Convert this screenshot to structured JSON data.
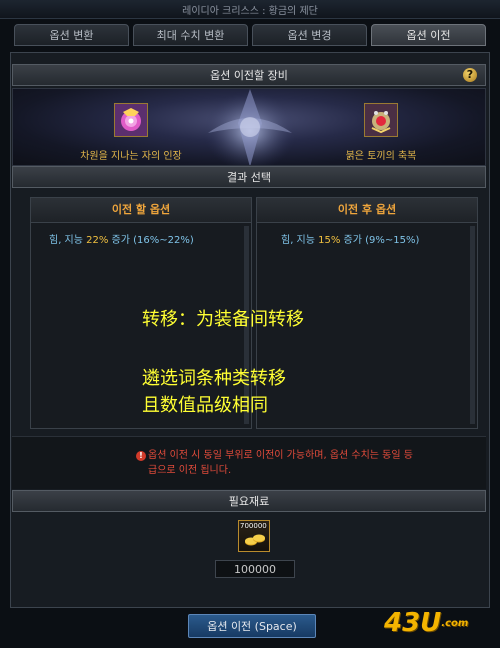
{
  "window": {
    "title": "레이디아 크리스스 : 황금의 제단"
  },
  "tabs": [
    {
      "label": "옵션 변환",
      "active": false
    },
    {
      "label": "최대 수치 변환",
      "active": false
    },
    {
      "label": "옵션 변경",
      "active": false
    },
    {
      "label": "옵션 이전",
      "active": true
    }
  ],
  "transfer_equipment": {
    "header": "옵션 이전할 장비",
    "help_icon": "?",
    "left_item": {
      "name": "차원을 지나는 자의 인장",
      "icon": "seal-icon"
    },
    "right_item": {
      "name": "붉은 토끼의 축복",
      "icon": "rabbit-blessing-icon"
    }
  },
  "result": {
    "header": "결과 선택",
    "before": {
      "title": "이전 할 옵션",
      "option_prefix": "힘, 지능 ",
      "option_value": "22%",
      "option_suffix": " 증가 (16%~22%)"
    },
    "after": {
      "title": "이전 후 옵션",
      "option_prefix": "힘, 지능 ",
      "option_value": "15%",
      "option_suffix": " 증가 (9%~15%)"
    }
  },
  "annotation": {
    "line1": "转移：为装备间转移",
    "line2": "遴选词条种类转移",
    "line3": "且数值品级相同"
  },
  "warning": {
    "icon": "!",
    "text": "옵션 이전 시 동일 부위로 이전이 가능하며, 옵션 수치는 동일 등급으로 이전 됩니다."
  },
  "materials": {
    "header": "필요재료",
    "item_count": "700000",
    "quantity": "100000"
  },
  "footer": {
    "button_label": "옵션 이전 (Space)"
  },
  "watermark": {
    "main": "43U",
    "suffix": ".com"
  },
  "colors": {
    "accent_orange": "#f0a63c",
    "option_blue": "#7fc3e8",
    "highlight_yellow": "#f0c040",
    "warning_red": "#e24b3b",
    "annotation_yellow": "#ffff33"
  }
}
